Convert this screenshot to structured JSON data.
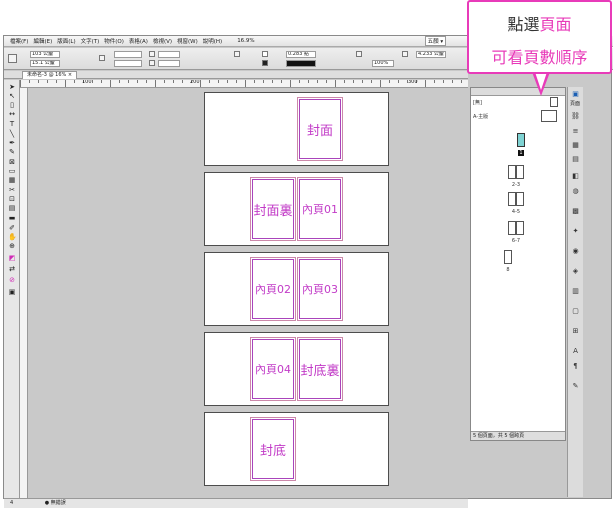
{
  "menubar": {
    "items": [
      "檔案(F)",
      "編輯(E)",
      "版面(L)",
      "文字(T)",
      "物件(O)",
      "表格(A)",
      "檢視(V)",
      "視窗(W)",
      "說明(H)"
    ],
    "zoom": "16.9%",
    "workspace": "五顏 ▾"
  },
  "control": {
    "x_value": "103 公釐",
    "y_value": "15.1 公釐",
    "stroke_weight": "0.283 點",
    "scale": "100%",
    "width_value": "4.233 公釐"
  },
  "document_tab": "未命名-3 @ 16% ×",
  "ruler": {
    "marks": [
      "100",
      "200",
      "300"
    ]
  },
  "spreads": [
    {
      "pages": [
        "封面"
      ]
    },
    {
      "pages": [
        "封面裏",
        "內頁01"
      ]
    },
    {
      "pages": [
        "內頁02",
        "內頁03"
      ]
    },
    {
      "pages": [
        "內頁04",
        "封底裏"
      ]
    },
    {
      "pages": [
        "封底"
      ]
    }
  ],
  "status": {
    "page": "4",
    "state": "● 無錯誤"
  },
  "pages_panel": {
    "master_label": "[無]",
    "master_a": "A-主版",
    "page_numbers": [
      "1",
      "2-3",
      "4-5",
      "6-7",
      "8"
    ],
    "footer": "5 個頁面，共 5 個跨頁"
  },
  "sidebar": {
    "pages_tab": "頁面"
  },
  "callout": {
    "line1_prefix": "點選",
    "line1_highlight": "頁面",
    "line2": "可看頁數順序"
  },
  "colors": {
    "accent": "#e83bb9",
    "page_text": "#c23bc7"
  }
}
